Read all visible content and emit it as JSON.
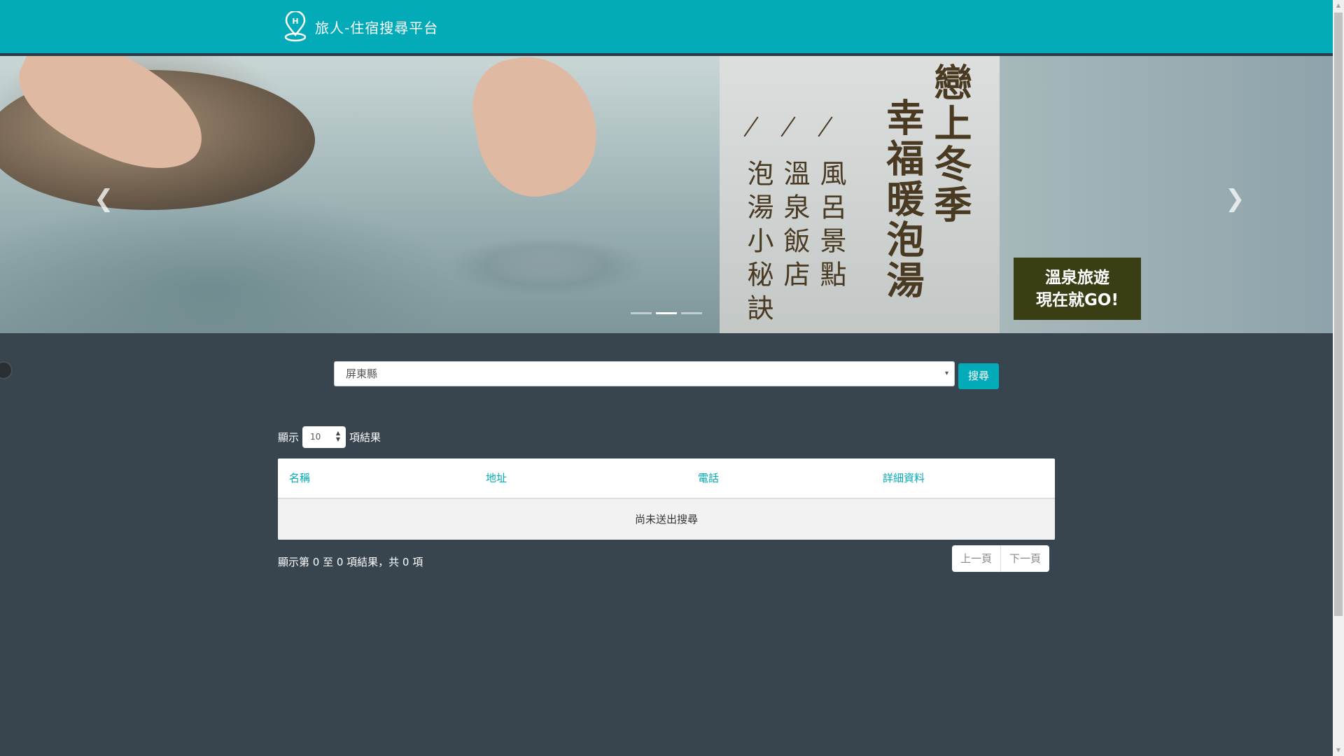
{
  "navbar": {
    "brand_text": "旅人-住宿搜尋平台",
    "brand_icon": "hotel-location-pin-icon"
  },
  "carousel": {
    "headline_col1": "戀上冬季",
    "headline_col2": "幸福暖泡湯",
    "sub_col1": "風呂景點",
    "sub_col2": "溫泉飯店",
    "sub_col3": "泡湯小秘訣",
    "badge_line1": "溫泉旅遊",
    "badge_line2": "現在就GO!",
    "prev_icon": "chevron-left-icon",
    "next_icon": "chevron-right-icon",
    "slide_count": 3,
    "active_slide": 2
  },
  "search": {
    "selected_region": "屏東縣",
    "button_label": "搜尋"
  },
  "length": {
    "prefix": "顯示",
    "value": "10",
    "suffix": "項結果"
  },
  "table": {
    "columns": [
      "名稱",
      "地址",
      "電話",
      "詳細資料"
    ],
    "empty_message": "尚未送出搜尋"
  },
  "info": {
    "text": "顯示第 0 至 0 項結果，共 0 項"
  },
  "pager": {
    "prev_label": "上一頁",
    "next_label": "下一頁"
  },
  "colors": {
    "accent": "#02abb7",
    "background": "#38454f"
  }
}
